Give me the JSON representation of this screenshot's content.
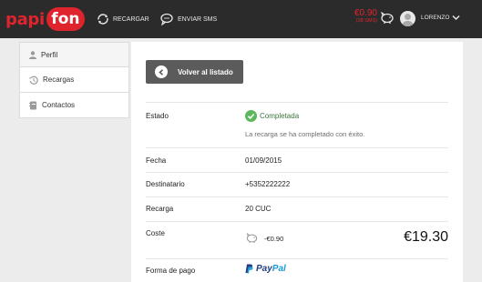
{
  "brand": {
    "logo_part1": "papi",
    "logo_part2": "fon",
    "accent": "#e0242d"
  },
  "topnav": {
    "recargar": "RECARGAR",
    "enviar_sms": "ENVIAR SMS",
    "balance_amount": "€0.90",
    "balance_sms": "(28 SMS)",
    "username": "LORENZO"
  },
  "sidebar": {
    "items": [
      {
        "label": "Perfil",
        "icon": "user-icon"
      },
      {
        "label": "Recargas",
        "icon": "history-icon"
      },
      {
        "label": "Contactos",
        "icon": "address-book-icon"
      }
    ]
  },
  "main": {
    "back_label": "Volver al listado",
    "fields": {
      "estado_label": "Estado",
      "estado_value": "Completada",
      "estado_desc": "La recarga se ha completado con éxito.",
      "fecha_label": "Fecha",
      "fecha_value": "01/09/2015",
      "destinatario_label": "Destinatario",
      "destinatario_value": "+5352222222",
      "recarga_label": "Recarga",
      "recarga_value": "20 CUC",
      "coste_label": "Coste",
      "coste_discount": "-€0.90",
      "coste_total": "€19.30",
      "forma_pago_label": "Forma de pago",
      "paypal_pay": "Pay",
      "paypal_pal": "Pal"
    }
  }
}
